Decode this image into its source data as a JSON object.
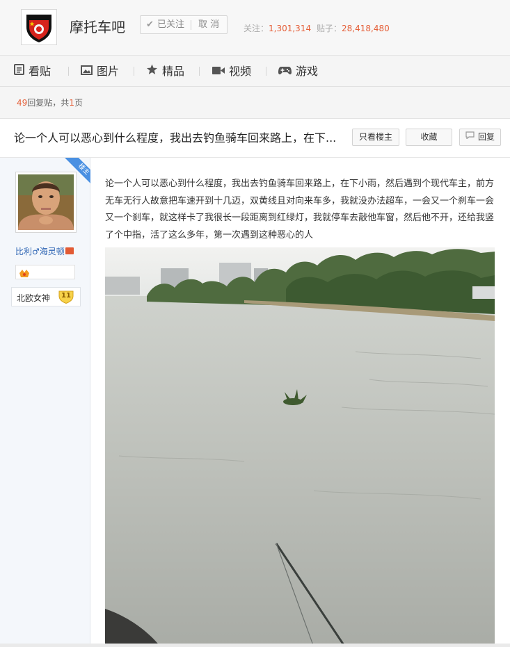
{
  "forum": {
    "name": "摩托车吧",
    "followed_label": "已关注",
    "unfollow_label": "取 消",
    "follow_label": "关注：",
    "follow_count": "1,301,314",
    "posts_label": "贴子：",
    "posts_count": "28,418,480",
    "accent_color": "#e5603a"
  },
  "nav": {
    "items": [
      {
        "label": "看贴",
        "icon": "document-icon"
      },
      {
        "label": "图片",
        "icon": "image-icon"
      },
      {
        "label": "精品",
        "icon": "star-icon"
      },
      {
        "label": "视频",
        "icon": "video-camera-icon"
      },
      {
        "label": "游戏",
        "icon": "gamepad-icon"
      }
    ]
  },
  "reply_summary": {
    "count": "49",
    "count_suffix": "回复贴，共",
    "pages": "1",
    "pages_suffix": "页"
  },
  "thread": {
    "title": "论一个人可以恶心到什么程度，我出去钓鱼骑车回来路上，在下...",
    "only_op_label": "只看楼主",
    "favorite_label": "收藏",
    "reply_label": "回复"
  },
  "post": {
    "op_badge": "楼主",
    "username": "比利♂海灵顿",
    "level_name": "北欧女神",
    "level_number": "11",
    "body": "论一个人可以恶心到什么程度，我出去钓鱼骑车回来路上，在下小雨，然后遇到个现代车主，前方无车无行人故意把车速开到十几迈，双黄线且对向来车多，我就没办法超车，一会又一个刹车一会又一个刹车，就这样卡了我很长一段距离到红绿灯，我就停车去敲他车窗，然后他不开，还给我竖了个中指，活了这么多年，第一次遇到这种恶心的人",
    "image": "river-fishing-photo"
  }
}
